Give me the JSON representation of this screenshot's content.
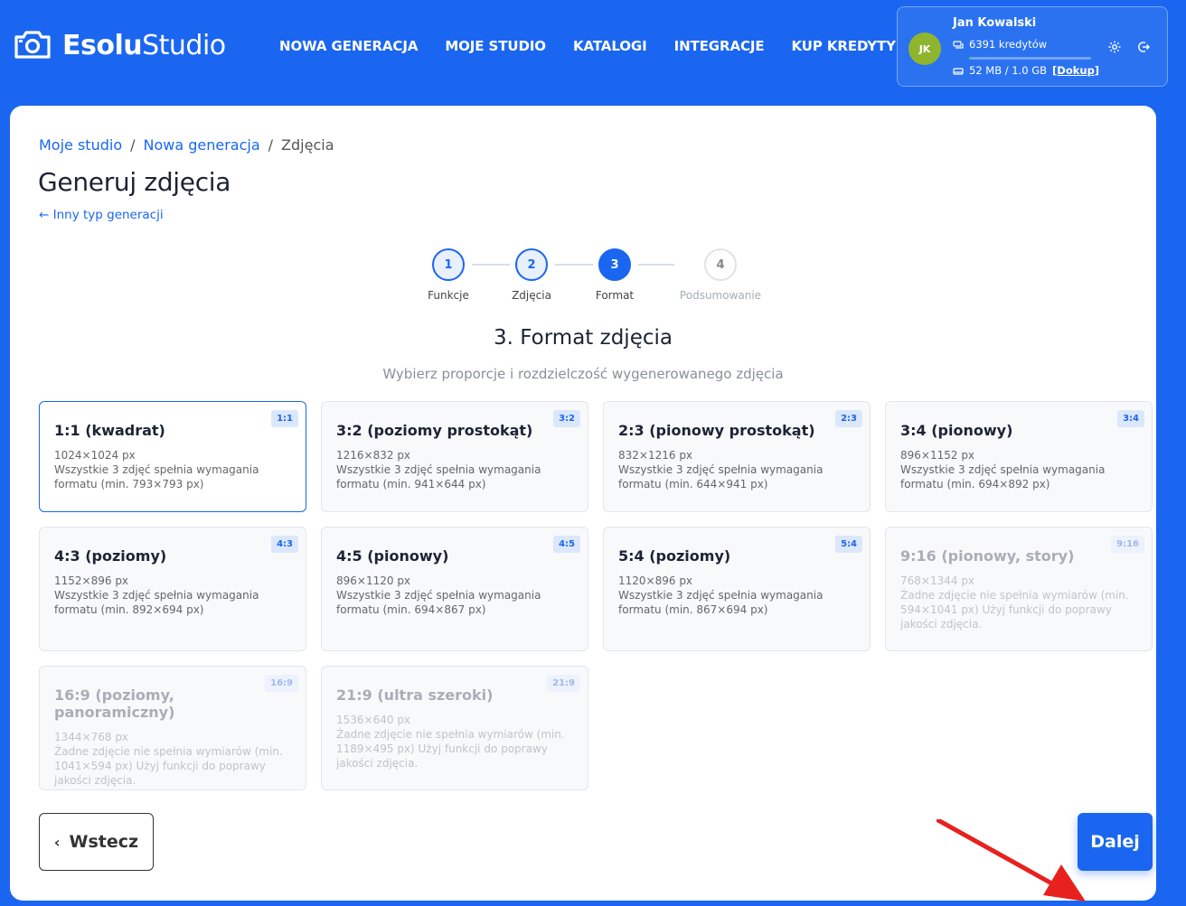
{
  "app": {
    "brand_bold": "Esolu",
    "brand_light": "Studio"
  },
  "nav": [
    "NOWA GENERACJA",
    "MOJE STUDIO",
    "KATALOGI",
    "INTEGRACJE",
    "KUP KREDYTY"
  ],
  "user": {
    "initials": "JK",
    "name": "Jan Kowalski",
    "credits": "6391 kredytów",
    "credits_fraction": 0.02,
    "storage": "52 MB / 1.0 GB",
    "topup": "[Dokup]"
  },
  "breadcrumb": [
    "Moje studio",
    "Nowa generacja",
    "Zdjęcia"
  ],
  "breadcrumb_sep": "/",
  "page_title": "Generuj zdjęcia",
  "back_link": "← Inny typ generacji",
  "steps": [
    {
      "num": "1",
      "label": "Funkcje",
      "state": "done"
    },
    {
      "num": "2",
      "label": "Zdjęcia",
      "state": "done"
    },
    {
      "num": "3",
      "label": "Format",
      "state": "active"
    },
    {
      "num": "4",
      "label": "Podsumowanie",
      "state": "todo"
    }
  ],
  "section": {
    "title": "3. Format zdjęcia",
    "subtitle": "Wybierz proporcje i rozdzielczość wygenerowanego zdjęcia"
  },
  "formats": [
    {
      "title": "1:1 (kwadrat)",
      "badge": "1:1",
      "res": "1024×1024 px",
      "note": "Wszystkie 3 zdjęć spełnia wymagania formatu (min. 793×793 px)",
      "state": "selected"
    },
    {
      "title": "3:2 (poziomy prostokąt)",
      "badge": "3:2",
      "res": "1216×832 px",
      "note": "Wszystkie 3 zdjęć spełnia wymagania formatu (min. 941×644 px)",
      "state": "enabled"
    },
    {
      "title": "2:3 (pionowy prostokąt)",
      "badge": "2:3",
      "res": "832×1216 px",
      "note": "Wszystkie 3 zdjęć spełnia wymagania formatu (min. 644×941 px)",
      "state": "enabled"
    },
    {
      "title": "3:4 (pionowy)",
      "badge": "3:4",
      "res": "896×1152 px",
      "note": "Wszystkie 3 zdjęć spełnia wymagania formatu (min. 694×892 px)",
      "state": "enabled"
    },
    {
      "title": "4:3 (poziomy)",
      "badge": "4:3",
      "res": "1152×896 px",
      "note": "Wszystkie 3 zdjęć spełnia wymagania formatu (min. 892×694 px)",
      "state": "enabled"
    },
    {
      "title": "4:5 (pionowy)",
      "badge": "4:5",
      "res": "896×1120 px",
      "note": "Wszystkie 3 zdjęć spełnia wymagania formatu (min. 694×867 px)",
      "state": "enabled"
    },
    {
      "title": "5:4 (poziomy)",
      "badge": "5:4",
      "res": "1120×896 px",
      "note": "Wszystkie 3 zdjęć spełnia wymagania formatu (min. 867×694 px)",
      "state": "enabled"
    },
    {
      "title": "9:16 (pionowy, story)",
      "badge": "9:16",
      "res": "768×1344 px",
      "note": "Żadne zdjęcie nie spełnia wymiarów (min. 594×1041 px) Użyj funkcji do poprawy jakości zdjęcia.",
      "state": "disabled"
    },
    {
      "title": "16:9 (poziomy, panoramiczny)",
      "badge": "16:9",
      "res": "1344×768 px",
      "note": "Żadne zdjęcie nie spełnia wymiarów (min. 1041×594 px) Użyj funkcji do poprawy jakości zdjęcia.",
      "state": "disabled"
    },
    {
      "title": "21:9 (ultra szeroki)",
      "badge": "21:9",
      "res": "1536×640 px",
      "note": "Żadne zdjęcie nie spełnia wymiarów (min. 1189×495 px) Użyj funkcji do poprawy jakości zdjęcia.",
      "state": "disabled"
    }
  ],
  "buttons": {
    "back": "Wstecz",
    "next": "Dalej"
  },
  "colors": {
    "primary": "#1a66f0",
    "annotation_arrow": "#e8211e",
    "avatar": "#8fb52e",
    "progress": "#2fd07a"
  },
  "icons": [
    "camera-icon",
    "coins-icon",
    "storage-icon",
    "settings-icon",
    "logout-icon",
    "chevron-left-icon"
  ]
}
